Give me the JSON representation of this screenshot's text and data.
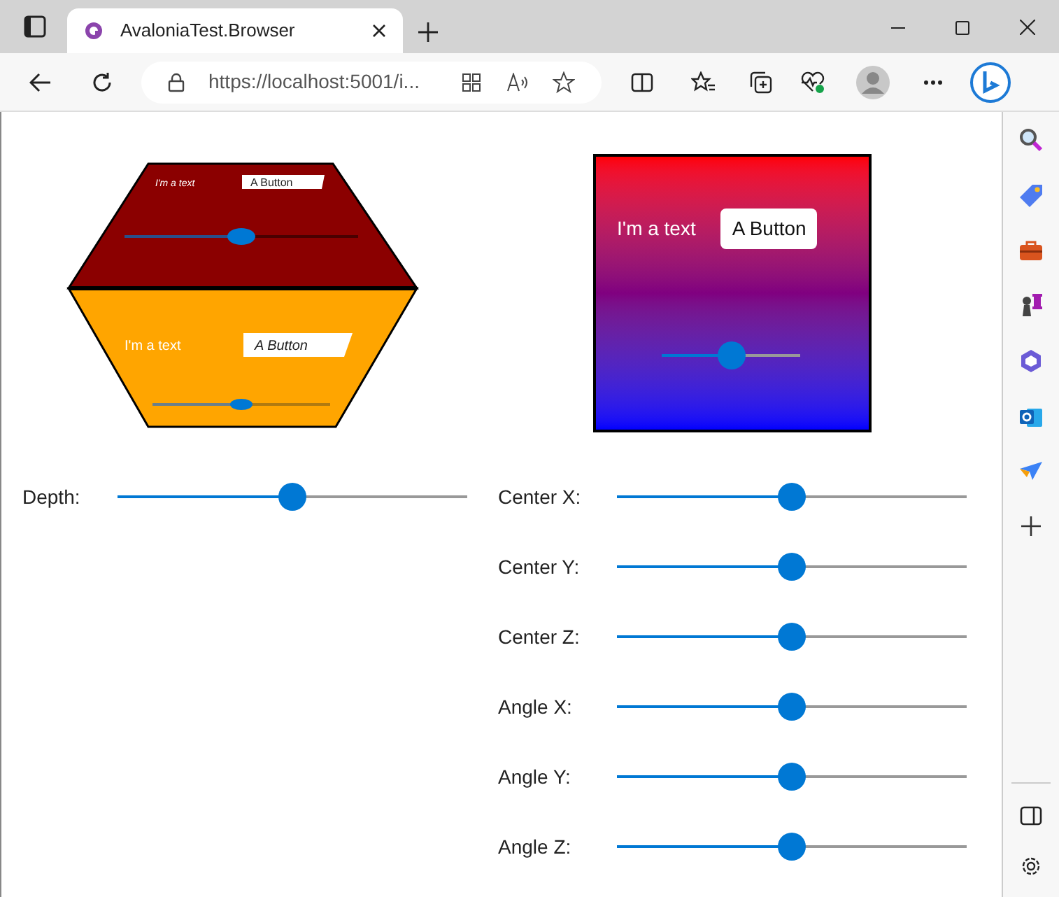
{
  "browser": {
    "tab_title": "AvaloniaTest.Browser",
    "url": "https://localhost:5001/i..."
  },
  "cube": {
    "faces": [
      {
        "kind": "top",
        "text": "I'm a text",
        "button": "A Button",
        "level": 0.5
      },
      {
        "kind": "front",
        "text": "I'm a text",
        "button": "A Button",
        "level": 0.5
      }
    ]
  },
  "panel": {
    "text": "I'm a text",
    "button": "A Button",
    "level": 0.5
  },
  "controls": [
    {
      "label": "Depth:",
      "level": 0.5
    },
    {
      "label": "Center X:",
      "level": 0.5
    },
    {
      "label": "Center Y:",
      "level": 0.5
    },
    {
      "label": "Center Z:",
      "level": 0.5
    },
    {
      "label": "Angle X:",
      "level": 0.5
    },
    {
      "label": "Angle Y:",
      "level": 0.5
    },
    {
      "label": "Angle Z:",
      "level": 0.5
    }
  ]
}
